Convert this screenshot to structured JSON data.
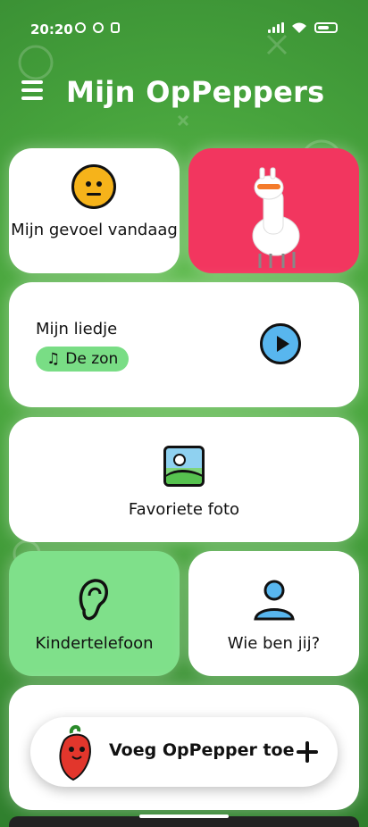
{
  "status_bar": {
    "time": "20:20"
  },
  "header": {
    "title": "Mijn OpPeppers"
  },
  "cards": {
    "feeling": {
      "label": "Mijn gevoel vandaag"
    },
    "song": {
      "title": "Mijn liedje",
      "chip": "De zon"
    },
    "photo": {
      "label": "Favoriete foto"
    },
    "helpline": {
      "label": "Kindertelefoon"
    },
    "who": {
      "label": "Wie ben jij?"
    }
  },
  "fab": {
    "label": "Voeg OpPepper toe"
  },
  "colors": {
    "background_green": "#46a23c",
    "accent_pink": "#f2365f",
    "chip_green": "#79dd85",
    "helpline_green": "#7fe08a",
    "play_blue": "#58b6ee"
  },
  "icons": [
    "menu-icon",
    "whatsapp-icon",
    "info-icon",
    "phone-icon",
    "signal-icon",
    "wifi-icon",
    "battery-icon",
    "neutral-face-icon",
    "llama-illustration",
    "music-note-icon",
    "play-icon",
    "photo-icon",
    "ear-icon",
    "person-icon",
    "pepper-mascot",
    "plus-icon"
  ]
}
